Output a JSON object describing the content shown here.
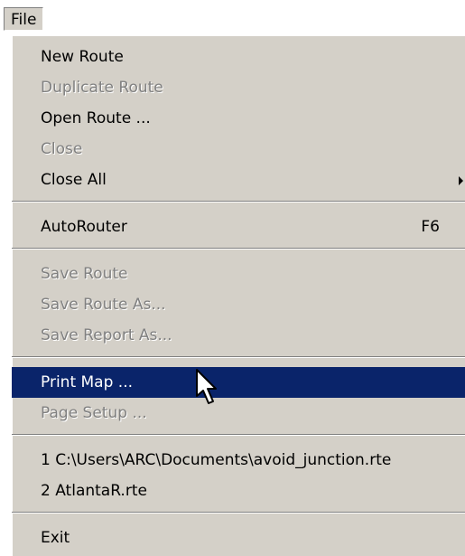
{
  "menubar": {
    "file_label": "File"
  },
  "file_menu": {
    "new_route": "New Route",
    "duplicate_route": "Duplicate Route",
    "open_route": "Open Route ...",
    "close": "Close",
    "close_all": "Close All",
    "autorouter": "AutoRouter",
    "autorouter_shortcut": "F6",
    "save_route": "Save Route",
    "save_route_as": "Save Route As...",
    "save_report_as": "Save Report As...",
    "print_map": "Print Map ...",
    "page_setup": "Page Setup ...",
    "recent_files": [
      "1 C:\\Users\\ARC\\Documents\\avoid_junction.rte",
      "2 AtlantaR.rte"
    ],
    "exit": "Exit"
  },
  "colors": {
    "menu_background": "#d4d0c8",
    "highlight": "#0a246a",
    "highlight_text": "#ffffff",
    "disabled_text": "#808080"
  },
  "icons": {
    "submenu": "chevron-right-icon",
    "pointer": "mouse-pointer-icon"
  }
}
